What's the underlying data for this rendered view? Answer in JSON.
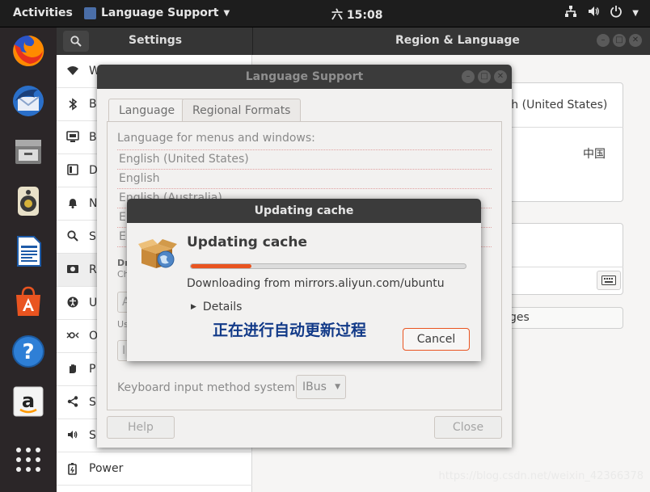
{
  "topbar": {
    "activities": "Activities",
    "app_menu": "Language Support",
    "clock": "六 15:08"
  },
  "dock": {
    "items": [
      "firefox-icon",
      "thunderbird-icon",
      "files-icon",
      "rhythmbox-icon",
      "writer-icon",
      "software-icon",
      "help-icon",
      "amazon-icon",
      "app-grid-icon"
    ]
  },
  "settings": {
    "title_left": "Settings",
    "title_right": "Region & Language",
    "sidebar": [
      {
        "icon": "wifi-icon",
        "label": "W"
      },
      {
        "icon": "bluetooth-icon",
        "label": "B"
      },
      {
        "icon": "background-icon",
        "label": "B"
      },
      {
        "icon": "dock-icon",
        "label": "D"
      },
      {
        "icon": "notifications-icon",
        "label": "N"
      },
      {
        "icon": "search-icon",
        "label": "S"
      },
      {
        "icon": "region-icon",
        "label": "R"
      },
      {
        "icon": "universal-access-icon",
        "label": "U"
      },
      {
        "icon": "online-accounts-icon",
        "label": "O"
      },
      {
        "icon": "privacy-icon",
        "label": "P"
      },
      {
        "icon": "sharing-icon",
        "label": "S"
      },
      {
        "icon": "sound-icon",
        "label": "S"
      },
      {
        "icon": "power-icon",
        "label": "Power"
      }
    ],
    "region": {
      "language_value": "sh (United States)",
      "formats_value": "中国",
      "manage_button": "ges"
    }
  },
  "language_support": {
    "title": "Language Support",
    "tabs": [
      "Language",
      "Regional Formats"
    ],
    "menus_label": "Language for menus and windows:",
    "languages": [
      "English (United States)",
      "English",
      "English (Australia)",
      "E",
      "E"
    ],
    "partial_labels": [
      "Dr",
      "Ch",
      "A",
      "Us",
      "I"
    ],
    "keyboard_label": "Keyboard input method system:",
    "keyboard_value": "IBus",
    "help_button": "Help",
    "close_button": "Close"
  },
  "cache_dialog": {
    "title": "Updating cache",
    "heading": "Updating cache",
    "progress": 0.22,
    "status": "Downloading from mirrors.aliyun.com/ubuntu",
    "details": "Details",
    "annotation": "正在进行自动更新过程",
    "cancel": "Cancel"
  },
  "watermark": "https://blog.csdn.net/weixin_42366378",
  "colors": {
    "accent": "#e95420",
    "dock_bg": "#2b2628",
    "topbar_bg": "#1d1d1d",
    "annotation": "#123a88"
  }
}
